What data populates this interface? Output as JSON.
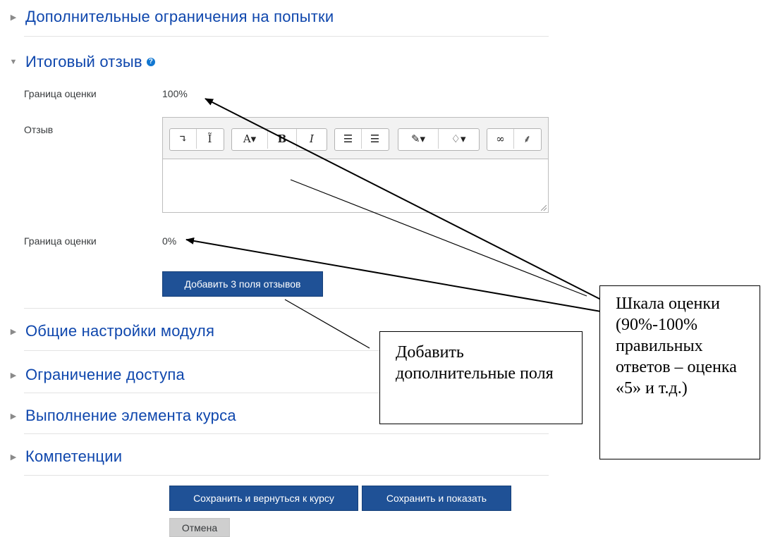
{
  "sections": {
    "attempt_restrictions": "Дополнительные ограничения на попытки",
    "overall_feedback": "Итоговый отзыв",
    "common_settings": "Общие настройки модуля",
    "access_restriction": "Ограничение доступа",
    "completion": "Выполнение элемента курса",
    "competencies": "Компетенции"
  },
  "feedback": {
    "boundary_label_1": "Граница оценки",
    "boundary_value_1": "100%",
    "feedback_label": "Отзыв",
    "boundary_label_2": "Граница оценки",
    "boundary_value_2": "0%",
    "add_fields_button": "Добавить 3 поля отзывов"
  },
  "editor": {
    "toolbar": {
      "groups": [
        [
          "↴",
          "I"
        ],
        [
          "A▾",
          "B",
          "I"
        ],
        [
          "☰",
          "☷"
        ],
        [
          "✎▾",
          "💡▾"
        ],
        [
          "🔗",
          "⛓"
        ]
      ]
    }
  },
  "actions": {
    "save_return": "Сохранить и вернуться к курсу",
    "save_display": "Сохранить и показать",
    "cancel": "Отмена"
  },
  "annotations": {
    "add_fields": "Добавить дополнительные поля",
    "grade_scale": "Шкала оценки (90%-100% правильных ответов – оценка «5» и т.д.)"
  },
  "colors": {
    "link_blue": "#0f47ad",
    "primary_button": "#1f5196",
    "secondary_button": "#cfcfcf"
  }
}
